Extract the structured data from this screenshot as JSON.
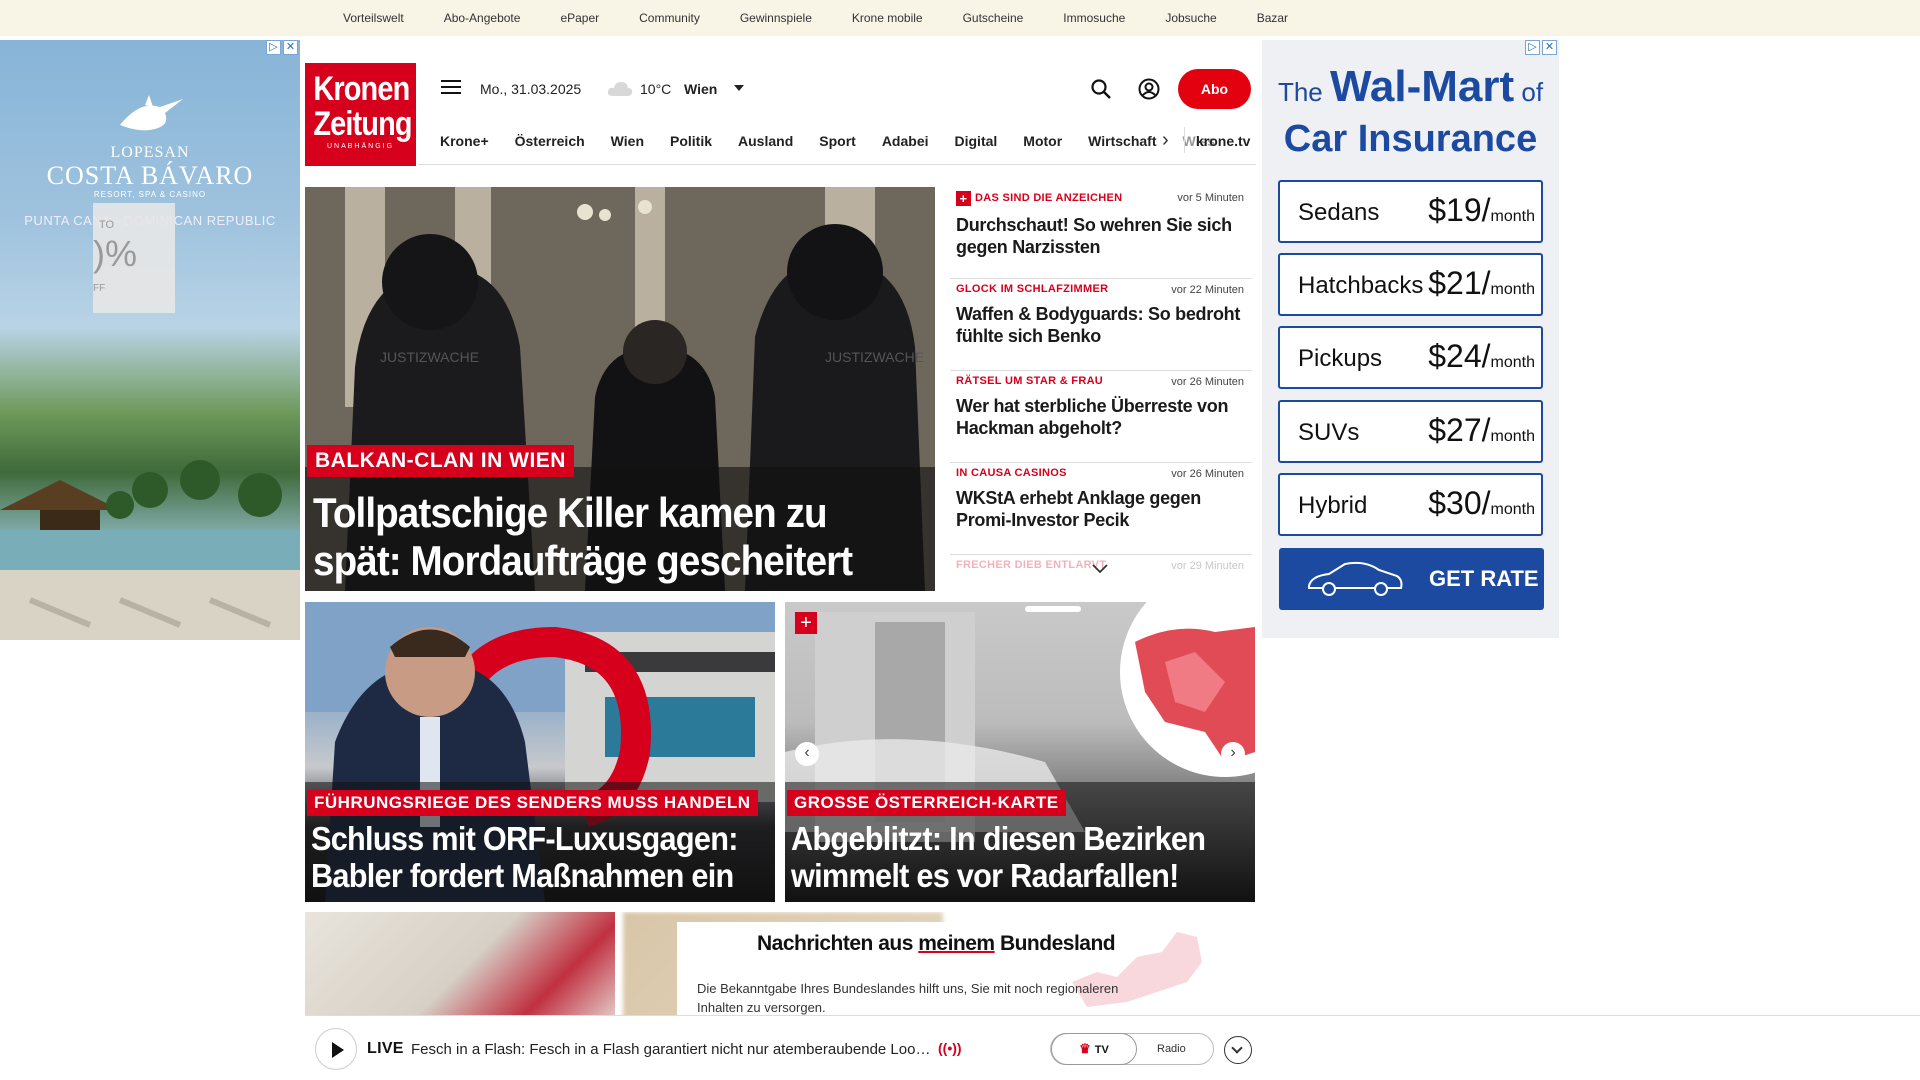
{
  "topbar": {
    "links": [
      "Vorteilswelt",
      "Abo-Angebote",
      "ePaper",
      "Community",
      "Gewinnspiele",
      "Krone mobile",
      "Gutscheine",
      "Immosuche",
      "Jobsuche",
      "Bazar"
    ]
  },
  "ad_left": {
    "brand_top": "LOPESAN",
    "brand_main": "COSTA BÁVARO",
    "brand_sub": "RESORT, SPA & CASINO",
    "location": "PUNTA CANA - DOMINICAN REPUBLIC",
    "offer_top": "TO",
    "offer_main": ")%",
    "offer_bottom": "FF"
  },
  "ad_right": {
    "title_pre": "The",
    "title_brand": "Wal-Mart",
    "title_post": "of",
    "title_line2": "Car Insurance",
    "rates": [
      {
        "type": "Sedans",
        "price": "$19",
        "unit": "month"
      },
      {
        "type": "Hatchbacks",
        "price": "$21",
        "unit": "month"
      },
      {
        "type": "Pickups",
        "price": "$24",
        "unit": "month"
      },
      {
        "type": "SUVs",
        "price": "$27",
        "unit": "month"
      },
      {
        "type": "Hybrid",
        "price": "$30",
        "unit": "month"
      }
    ],
    "cta": "GET RATE"
  },
  "header": {
    "logo_line1": "Kronen",
    "logo_line2": "Zeitung",
    "logo_tag": "UNABHÄNGIG",
    "date": "Mo., 31.03.2025",
    "temperature": "10°C",
    "city": "Wien",
    "abo_label": "Abo"
  },
  "nav": {
    "items": [
      "Krone+",
      "Österreich",
      "Wien",
      "Politik",
      "Ausland",
      "Sport",
      "Adabei",
      "Digital",
      "Motor",
      "Wirtschaft",
      "Wiss"
    ],
    "tv_label": "krone.tv"
  },
  "hero": {
    "kicker": "BALKAN-CLAN IN WIEN",
    "headline": "Tollpatschige Killer kamen zu spät: Mordaufträge gescheitert"
  },
  "news": [
    {
      "kicker": "DAS SIND DIE ANZEICHEN",
      "time": "vor 5 Minuten",
      "headline": "Durchschaut! So wehren Sie sich gegen Narzissten",
      "plus": true
    },
    {
      "kicker": "GLOCK IM SCHLAFZIMMER",
      "time": "vor 22 Minuten",
      "headline": "Waffen & Bodyguards: So bedroht fühlte sich Benko",
      "plus": false
    },
    {
      "kicker": "RÄTSEL UM STAR & FRAU",
      "time": "vor 26 Minuten",
      "headline": "Wer hat sterbliche Überreste von Hackman abgeholt?",
      "plus": false
    },
    {
      "kicker": "IN CAUSA CASINOS",
      "time": "vor 26 Minuten",
      "headline": "WKStA erhebt Anklage gegen Promi-Investor Pecik",
      "plus": false
    },
    {
      "kicker": "FRECHER DIEB ENTLARVT",
      "time": "vor 29 Minuten",
      "headline": "",
      "plus": false
    }
  ],
  "card1": {
    "kicker": "FÜHRUNGSRIEGE DES SENDERS MUSS HANDELN",
    "headline": "Schluss mit ORF-Luxusgagen: Babler fordert Maßnahmen ein"
  },
  "card2": {
    "kicker": "GROSSE ÖSTERREICH-KARTE",
    "headline": "Abgeblitzt: In diesen Bezirken wimmelt es vor Radarfallen!"
  },
  "modal": {
    "title_pre": "Nachrichten aus ",
    "title_underlined": "meinem",
    "title_post": " Bundesland",
    "text": "Die Bekanntgabe Ihres Bundeslandes hilft uns, Sie mit noch regionaleren Inhalten zu versorgen."
  },
  "live": {
    "label": "LIVE",
    "text": "Fesch in a Flash: Fesch in a Flash garantiert nicht nur atemberaubende Looks, sondern auch jede Menge Spaß",
    "tv": "TV",
    "radio": "Radio"
  },
  "colors": {
    "brand_red": "#d6001c",
    "ad_blue": "#1b4aa0",
    "topbar_bg": "#f8f4e6"
  }
}
